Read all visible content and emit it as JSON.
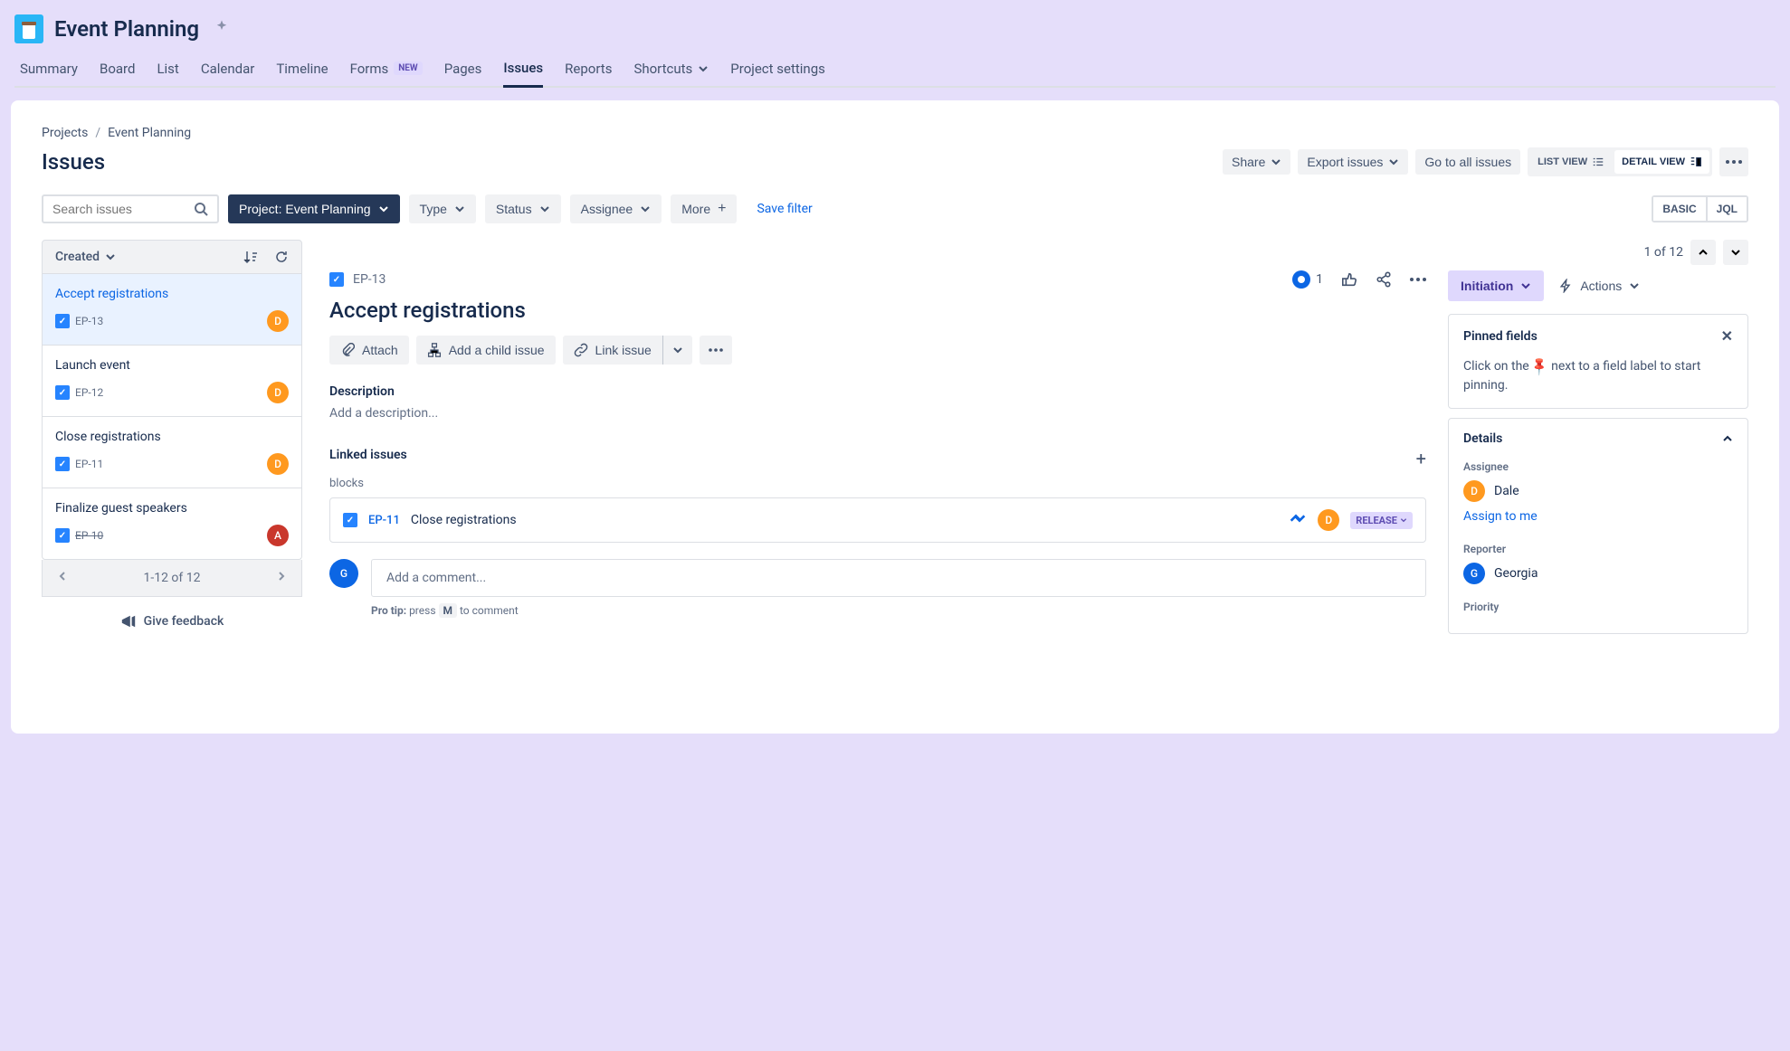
{
  "header": {
    "projectTitle": "Event Planning",
    "tabs": [
      "Summary",
      "Board",
      "List",
      "Calendar",
      "Timeline",
      "Forms",
      "Pages",
      "Issues",
      "Reports",
      "Shortcuts",
      "Project settings"
    ],
    "formsBadge": "NEW",
    "activeTab": "Issues"
  },
  "breadcrumb": {
    "root": "Projects",
    "project": "Event Planning"
  },
  "page": {
    "title": "Issues",
    "actions": {
      "share": "Share",
      "export": "Export issues",
      "goToAll": "Go to all issues",
      "listView": "LIST VIEW",
      "detailView": "DETAIL VIEW"
    }
  },
  "filters": {
    "searchPlaceholder": "Search issues",
    "projectLabel": "Project:",
    "projectValue": "Event Planning",
    "type": "Type",
    "status": "Status",
    "assignee": "Assignee",
    "more": "More",
    "save": "Save filter",
    "basic": "BASIC",
    "jql": "JQL"
  },
  "list": {
    "sortBy": "Created",
    "items": [
      {
        "title": "Accept registrations",
        "key": "EP-13",
        "avatar": "D",
        "avatarClass": "d",
        "selected": true,
        "done": false
      },
      {
        "title": "Launch event",
        "key": "EP-12",
        "avatar": "D",
        "avatarClass": "d",
        "selected": false,
        "done": false
      },
      {
        "title": "Close registrations",
        "key": "EP-11",
        "avatar": "D",
        "avatarClass": "d",
        "selected": false,
        "done": false
      },
      {
        "title": "Finalize guest speakers",
        "key": "EP-10",
        "avatar": "A",
        "avatarClass": "a",
        "selected": false,
        "done": true
      }
    ],
    "pager": "1-12 of 12",
    "feedback": "Give feedback"
  },
  "paging": {
    "topLabel": "1 of 12"
  },
  "detail": {
    "key": "EP-13",
    "watchCount": "1",
    "title": "Accept registrations",
    "actions": {
      "attach": "Attach",
      "addChild": "Add a child issue",
      "linkIssue": "Link issue"
    },
    "descriptionLabel": "Description",
    "descriptionPlaceholder": "Add a description...",
    "linkedLabel": "Linked issues",
    "linkType": "blocks",
    "linkedIssue": {
      "key": "EP-11",
      "title": "Close registrations",
      "avatar": "D",
      "status": "RELEASE"
    },
    "commentPlaceholder": "Add a comment...",
    "proTipLabel": "Pro tip:",
    "proTipPre": "press",
    "proTipKey": "M",
    "proTipPost": "to comment"
  },
  "right": {
    "status": "Initiation",
    "actionsLabel": "Actions",
    "pinned": {
      "title": "Pinned fields",
      "textPre": "Click on the ",
      "textPost": " next to a field label to start pinning."
    },
    "details": {
      "title": "Details",
      "assigneeLabel": "Assignee",
      "assigneeName": "Dale",
      "assignLink": "Assign to me",
      "reporterLabel": "Reporter",
      "reporterName": "Georgia",
      "priorityLabel": "Priority"
    }
  }
}
